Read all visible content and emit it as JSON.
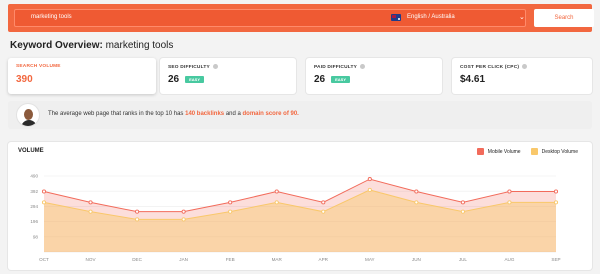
{
  "search": {
    "query": "marketing tools",
    "locale": "English / Australia",
    "button_label": "Search"
  },
  "title": {
    "prefix": "Keyword Overview:",
    "keyword": "marketing tools"
  },
  "metrics": [
    {
      "label": "SEARCH VOLUME",
      "value": "390"
    },
    {
      "label": "SEO DIFFICULTY",
      "value": "26",
      "badge": "EASY"
    },
    {
      "label": "PAID DIFFICULTY",
      "value": "26",
      "badge": "EASY"
    },
    {
      "label": "COST PER CLICK (CPC)",
      "value": "$4.61"
    }
  ],
  "insight": {
    "text_before": "The average web page that ranks in the top 10 has",
    "backlinks": "140 backlinks",
    "text_mid": "and a",
    "domain_score": "domain score of 90."
  },
  "colors": {
    "accent": "#f2673f",
    "mobile": "#f26b5b",
    "desktop": "#f9c86b",
    "badge": "#48c9a0"
  },
  "chart_data": {
    "type": "area",
    "title": "VOLUME",
    "categories": [
      "OCT",
      "NOV",
      "DEC",
      "JAN",
      "FEB",
      "MAR",
      "APR",
      "MAY",
      "JUN",
      "JUL",
      "AUG",
      "SEP"
    ],
    "yticks": [
      "490",
      "392",
      "294",
      "196",
      "98"
    ],
    "ylim": [
      0,
      490
    ],
    "legend_position": "top-right",
    "series": [
      {
        "name": "Mobile Volume",
        "values": [
          390,
          320,
          260,
          260,
          320,
          390,
          320,
          470,
          390,
          320,
          390,
          390
        ]
      },
      {
        "name": "Desktop Volume",
        "values": [
          320,
          260,
          210,
          210,
          260,
          320,
          260,
          400,
          320,
          260,
          320,
          320
        ]
      }
    ]
  }
}
